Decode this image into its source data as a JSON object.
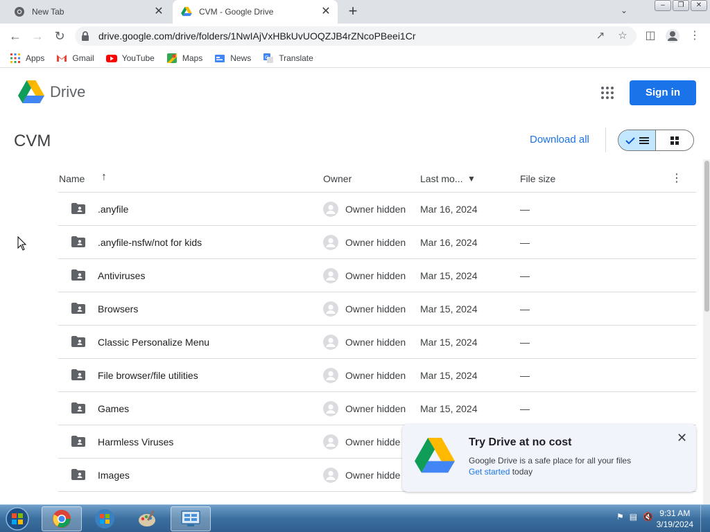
{
  "browser": {
    "tabs": [
      {
        "title": "New Tab",
        "icon": "chrome-icon"
      },
      {
        "title": "CVM - Google Drive",
        "icon": "drive-icon",
        "active": true
      }
    ],
    "new_tab_symbol": "+",
    "tab_close_symbol": "✕",
    "address": "drive.google.com/drive/folders/1NwIAjVxHBkUvUOQZJB4rZNcoPBeei1Cr",
    "window_buttons": [
      "minimize",
      "restore",
      "close"
    ]
  },
  "bookmarks": [
    {
      "label": "Apps",
      "icon": "apps-grid-icon"
    },
    {
      "label": "Gmail",
      "icon": "gmail-icon"
    },
    {
      "label": "YouTube",
      "icon": "youtube-icon"
    },
    {
      "label": "Maps",
      "icon": "maps-icon"
    },
    {
      "label": "News",
      "icon": "news-icon"
    },
    {
      "label": "Translate",
      "icon": "translate-icon"
    }
  ],
  "drive": {
    "product_name": "Drive",
    "sign_in_label": "Sign in",
    "folder_title": "CVM",
    "download_all_label": "Download all",
    "view_toggle": {
      "active": "list",
      "options": [
        "list",
        "grid"
      ]
    }
  },
  "table": {
    "columns": {
      "name": "Name",
      "owner": "Owner",
      "last_modified": "Last mo...",
      "file_size": "File size"
    },
    "sort": {
      "column": "name",
      "direction": "ascending"
    },
    "rows": [
      {
        "name": ".anyfile",
        "owner": "Owner hidden",
        "modified": "Mar 16, 2024",
        "size": "—"
      },
      {
        "name": ".anyfile-nsfw/not for kids",
        "owner": "Owner hidden",
        "modified": "Mar 16, 2024",
        "size": "—"
      },
      {
        "name": "Antiviruses",
        "owner": "Owner hidden",
        "modified": "Mar 15, 2024",
        "size": "—"
      },
      {
        "name": "Browsers",
        "owner": "Owner hidden",
        "modified": "Mar 15, 2024",
        "size": "—"
      },
      {
        "name": "Classic Personalize Menu",
        "owner": "Owner hidden",
        "modified": "Mar 15, 2024",
        "size": "—"
      },
      {
        "name": "File browser/file utilities",
        "owner": "Owner hidden",
        "modified": "Mar 15, 2024",
        "size": "—"
      },
      {
        "name": "Games",
        "owner": "Owner hidden",
        "modified": "Mar 15, 2024",
        "size": "—"
      },
      {
        "name": "Harmless Viruses",
        "owner": "Owner hidde",
        "modified": "",
        "size": ""
      },
      {
        "name": "Images",
        "owner": "Owner hidde",
        "modified": "",
        "size": ""
      }
    ]
  },
  "promo": {
    "title": "Try Drive at no cost",
    "body": "Google Drive is a safe place for all your files",
    "link": "Get started",
    "link_suffix": "today"
  },
  "taskbar": {
    "apps": [
      "chrome-icon",
      "windows-logo-icon",
      "paint-icon",
      "control-panel-icon"
    ],
    "clock_time": "9:31 AM",
    "clock_date": "3/19/2024"
  },
  "colors": {
    "accent": "#1a73e8",
    "toggle_active": "#c2e7ff",
    "promo_bg": "#f1f5fb",
    "tab_strip": "#dee1e6"
  }
}
